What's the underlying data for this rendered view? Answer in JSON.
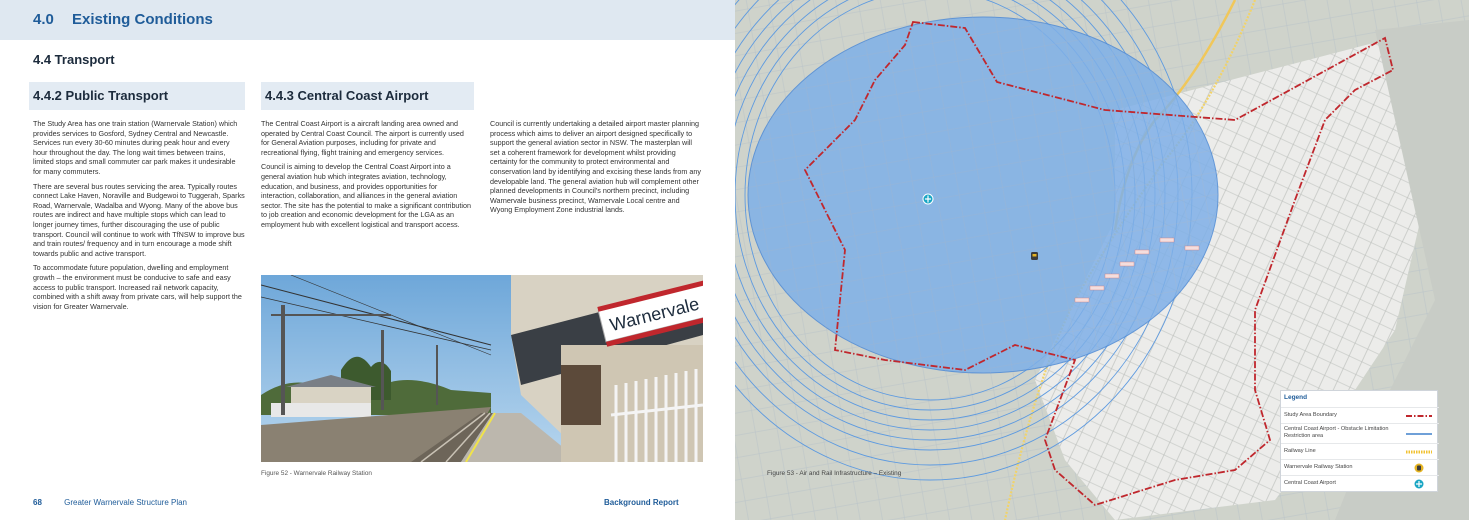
{
  "header": {
    "number": "4.0",
    "title": "Existing Conditions"
  },
  "section": {
    "title": "4.4  Transport"
  },
  "public_transport": {
    "heading": "4.4.2 Public Transport",
    "p1": "The Study Area has one train station (Warnervale Station) which provides services to Gosford, Sydney Central and Newcastle. Services run every 30-60 minutes during peak hour and every hour throughout the day. The long wait times between trains, limited stops and small commuter car park makes it undesirable for many commuters.",
    "p2": "There are several bus routes servicing the area. Typically routes connect Lake Haven, Noraville and Budgewoi to Tuggerah, Sparks Road, Warnervale, Wadalba and Wyong. Many of the above bus routes are indirect and have multiple stops which can lead to longer journey times, further discouraging the use of public transport. Council will continue to work with TfNSW to improve bus and train routes/ frequency and in turn encourage a mode shift towards public and active transport.",
    "p3": "To accommodate future population, dwelling and employment growth – the environment must be conducive to safe and easy access to public transport. Increased rail network capacity, combined with a shift away from private cars, will help support the vision for Greater Warnervale."
  },
  "airport": {
    "heading": "4.4.3   Central Coast Airport",
    "p1": "The Central Coast Airport is a aircraft landing area owned and operated by Central Coast Council. The airport is currently used for General Aviation purposes, including for private and recreational flying, flight training and emergency services.",
    "p2": "Council is aiming to develop the Central Coast Airport into a general aviation hub which integrates aviation, technology, education, and business, and provides opportunities for interaction, collaboration, and alliances in the general aviation sector. The site has the potential to make a significant contribution to job creation and economic development for the LGA as an employment hub with excellent logistical and transport access.",
    "p3": "Council is currently undertaking a detailed airport master planning process which aims to deliver an airport designed specifically to support the general aviation sector in NSW. The masterplan will set a coherent framework for development whilst providing certainty for the community to protect environmental and conservation land by identifying and excising these lands from any developable land. The general aviation hub will complement other planned developments in Council's northern precinct, including Warnervale business precinct, Warnervale Local centre and Wyong Employment Zone industrial lands."
  },
  "photo": {
    "sign_text": "Warnervale"
  },
  "figure52": {
    "caption": "Figure 52 - Warnervale Railway Station"
  },
  "figure53": {
    "caption": "Figure 53 - Air and Rail Infrastructure – Existing"
  },
  "footer": {
    "page": "68",
    "doc_title": "Greater Warnervale Structure Plan",
    "report": "Background Report"
  },
  "legend": {
    "title": "Legend",
    "items": [
      {
        "label": "Study Area Boundary",
        "symbol": "dash-dot-line",
        "color": "#c0272d"
      },
      {
        "label": "Central Coast Airport - Obstacle Limitation Restriction area",
        "symbol": "line",
        "color": "#6fa0d8"
      },
      {
        "label": "Railway Line",
        "symbol": "dotted-line",
        "color": "#f1c232"
      },
      {
        "label": "Warnervale Railway Station",
        "symbol": "train-icon",
        "color": "#e6b422"
      },
      {
        "label": "Central Coast Airport",
        "symbol": "airport-icon",
        "color": "#1aa6c4"
      }
    ]
  },
  "colors": {
    "accent": "#1f5c99",
    "header_band": "#dfe8f1",
    "boundary": "#c0272d",
    "olr_area": "#7fb0e8"
  }
}
